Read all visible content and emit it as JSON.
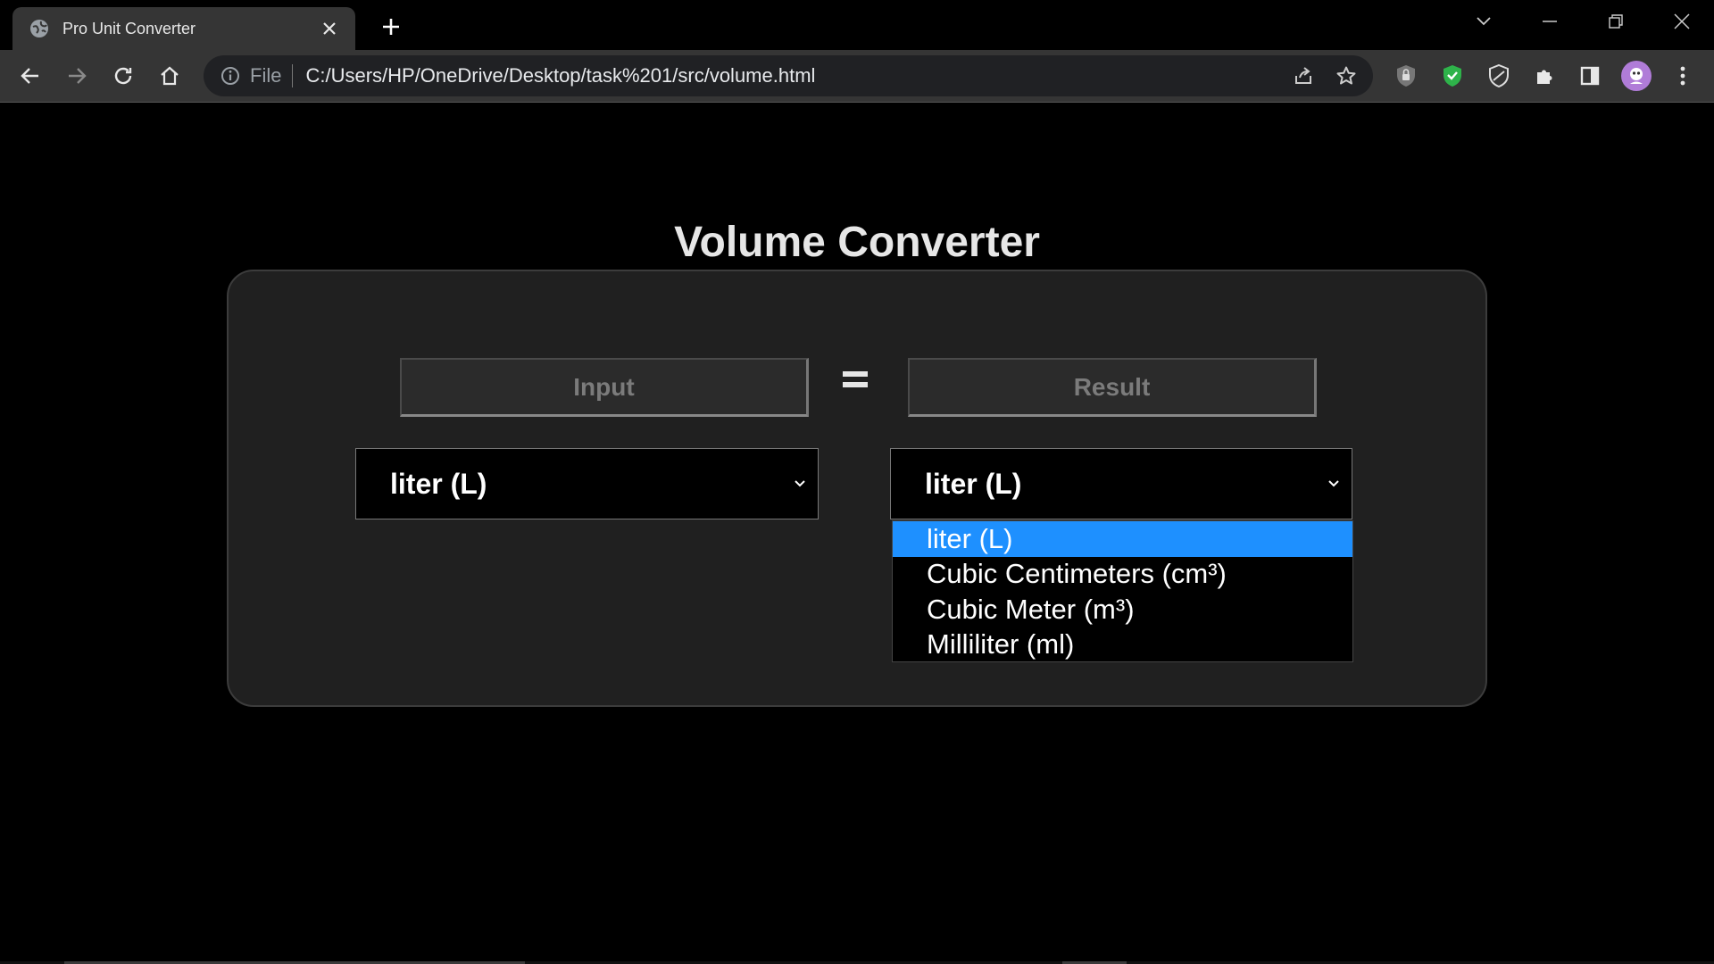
{
  "browser": {
    "tab_title": "Pro Unit Converter",
    "address": {
      "scheme_label": "File",
      "url": "C:/Users/HP/OneDrive/Desktop/task%201/src/volume.html"
    }
  },
  "page": {
    "title": "Volume Converter",
    "input": {
      "placeholder": "Input",
      "value": ""
    },
    "equals_symbol": "=",
    "result": {
      "placeholder": "Result",
      "value": ""
    },
    "from_unit": {
      "selected": "liter (L)"
    },
    "to_unit": {
      "selected": "liter (L)",
      "dropdown_open": true,
      "options": [
        {
          "label": "liter (L)",
          "highlighted": true
        },
        {
          "label": "Cubic Centimeters (cm³)",
          "highlighted": false
        },
        {
          "label": "Cubic Meter (m³)",
          "highlighted": false
        },
        {
          "label": "Milliliter (ml)",
          "highlighted": false
        }
      ]
    }
  },
  "colors": {
    "background": "#000000",
    "card": "#202020",
    "highlight": "#1e90ff",
    "shield_green": "#2eb34a",
    "avatar": "#b07cd8"
  },
  "icons": [
    "globe-icon",
    "close-icon",
    "plus-icon",
    "chevron-down-icon",
    "minimize-icon",
    "restore-icon",
    "back-icon",
    "forward-icon",
    "reload-icon",
    "home-icon",
    "info-icon",
    "share-icon",
    "star-icon",
    "privacy-badger-icon",
    "adblock-shield-icon",
    "vpn-shield-icon",
    "extensions-icon",
    "side-panel-icon",
    "profile-avatar",
    "kebab-menu-icon"
  ]
}
